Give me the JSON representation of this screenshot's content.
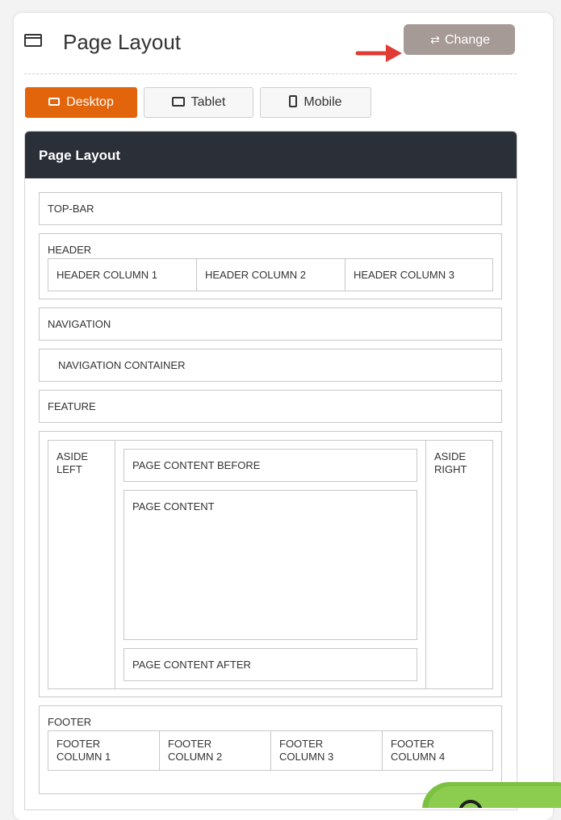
{
  "header": {
    "title": "Page Layout",
    "change_label": "Change"
  },
  "tabs": [
    {
      "label": "Desktop",
      "icon": "desktop-icon",
      "active": true
    },
    {
      "label": "Tablet",
      "icon": "tablet-icon",
      "active": false
    },
    {
      "label": "Mobile",
      "icon": "mobile-icon",
      "active": false
    }
  ],
  "panel": {
    "title": "Page Layout",
    "top_bar": "TOP-BAR",
    "header": {
      "label": "HEADER",
      "columns": [
        "HEADER COLUMN 1",
        "HEADER COLUMN 2",
        "HEADER COLUMN 3"
      ]
    },
    "navigation": "NAVIGATION",
    "navigation_container": "NAVIGATION CONTAINER",
    "feature": "FEATURE",
    "aside_left": "ASIDE LEFT",
    "aside_right": "ASIDE RIGHT",
    "page_content_before": "PAGE CONTENT BEFORE",
    "page_content": "PAGE CONTENT",
    "page_content_after": "PAGE CONTENT AFTER",
    "footer": {
      "label": "FOOTER",
      "columns": [
        "FOOTER COLUMN 1",
        "FOOTER COLUMN 2",
        "FOOTER COLUMN 3",
        "FOOTER COLUMN 4"
      ]
    }
  },
  "colors": {
    "accent": "#e2640b",
    "change_button": "#a69a97",
    "panel_header": "#2b2f38",
    "arrow": "#e03a33",
    "help_bubble": "#7cc142"
  }
}
